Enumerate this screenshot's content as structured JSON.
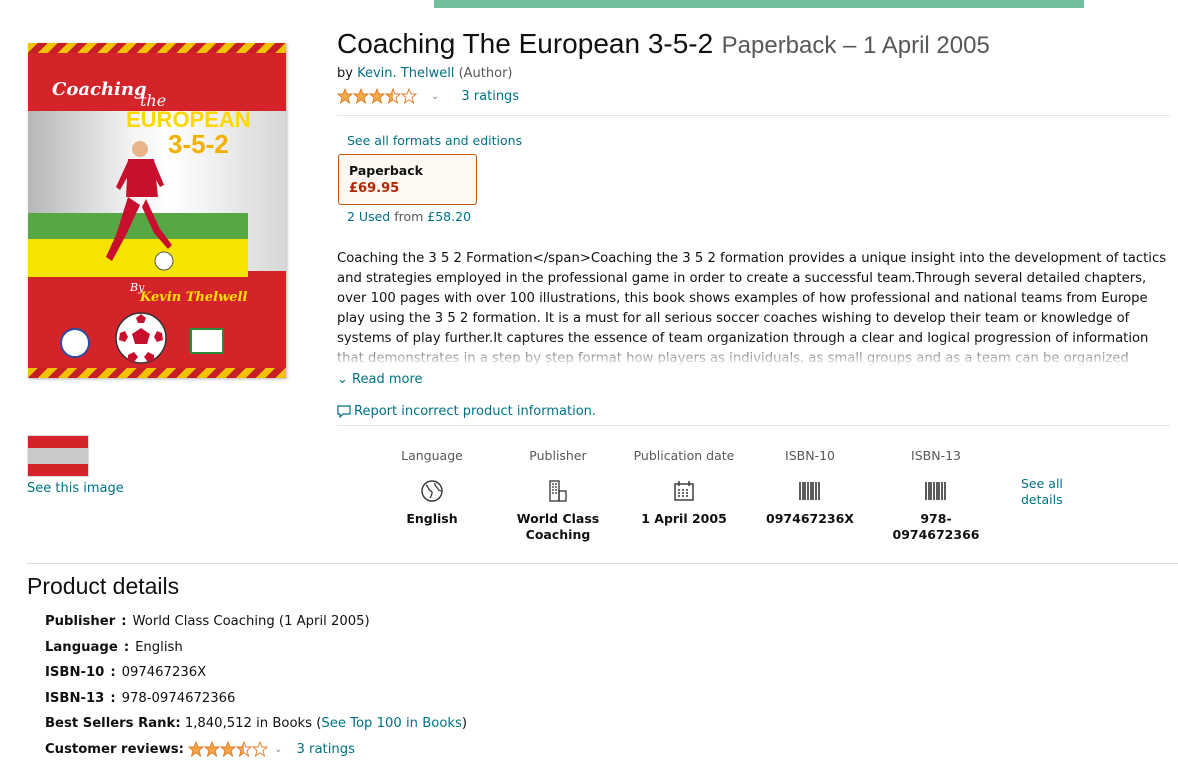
{
  "cover": {
    "title_line1": "Coaching",
    "title_line2": "the",
    "title_line3": "EUROPEAN",
    "title_line4": "3-5-2",
    "by": "By",
    "author": "Kevin Thelwell"
  },
  "gallery": {
    "see_image": "See this image"
  },
  "product": {
    "title": "Coaching The European 3-5-2",
    "format_date": "Paperback – 1 April 2005",
    "by_prefix": "by",
    "author": "Kevin. Thelwell",
    "author_role": "(Author)",
    "rating_value": 3.5,
    "ratings_count": "3 ratings"
  },
  "formats": {
    "see_all": "See all formats and editions",
    "selected_name": "Paperback",
    "selected_price": "£69.95",
    "used_link": "2 Used",
    "used_from": "from",
    "used_price": "£58.20"
  },
  "description": {
    "text": "Coaching the 3 5 2 Formation</span>Coaching the 3 5 2 formation provides a unique insight into the development of tactics and strategies employed in the professional game in order to create a successful team.Through several detailed chapters, over 100 pages with over 100 illustrations, this book shows examples of how professional and national teams from Europe play using the 3 5 2 formation. It is a must for all serious soccer coaches wishing to develop their team or knowledge of systems of play further.It captures the essence of team organization through a clear and logical progression of information that demonstrates in a step by step format how players as individuals, as small groups and as a team can be organized effectively both defensively and",
    "read_more": "Read more",
    "report": "Report incorrect product information."
  },
  "attributes": [
    {
      "label": "Language",
      "icon": "globe-icon",
      "value": "English"
    },
    {
      "label": "Publisher",
      "icon": "building-icon",
      "value": "World Class Coaching"
    },
    {
      "label": "Publication date",
      "icon": "calendar-icon",
      "value": "1 April 2005"
    },
    {
      "label": "ISBN-10",
      "icon": "barcode-icon",
      "value": "097467236X"
    },
    {
      "label": "ISBN-13",
      "icon": "barcode-icon",
      "value": "978-0974672366"
    }
  ],
  "see_all_details": "See all details",
  "details": {
    "heading": "Product details",
    "publisher_label": "Publisher",
    "publisher_value": "World Class Coaching (1 April 2005)",
    "language_label": "Language",
    "language_value": "English",
    "isbn10_label": "ISBN-10",
    "isbn10_value": "097467236X",
    "isbn13_label": "ISBN-13",
    "isbn13_value": "978-0974672366",
    "bsr_label": "Best Sellers Rank:",
    "bsr_value": "1,840,512 in Books",
    "bsr_link": "See Top 100 in Books",
    "reviews_label": "Customer reviews:",
    "reviews_count": "3 ratings",
    "colon": ":",
    "open_paren": "(",
    "close_paren": ")"
  },
  "colors": {
    "link": "#007185",
    "star": "#f3a847",
    "price": "#b12704",
    "selected_border": "#c45500"
  }
}
